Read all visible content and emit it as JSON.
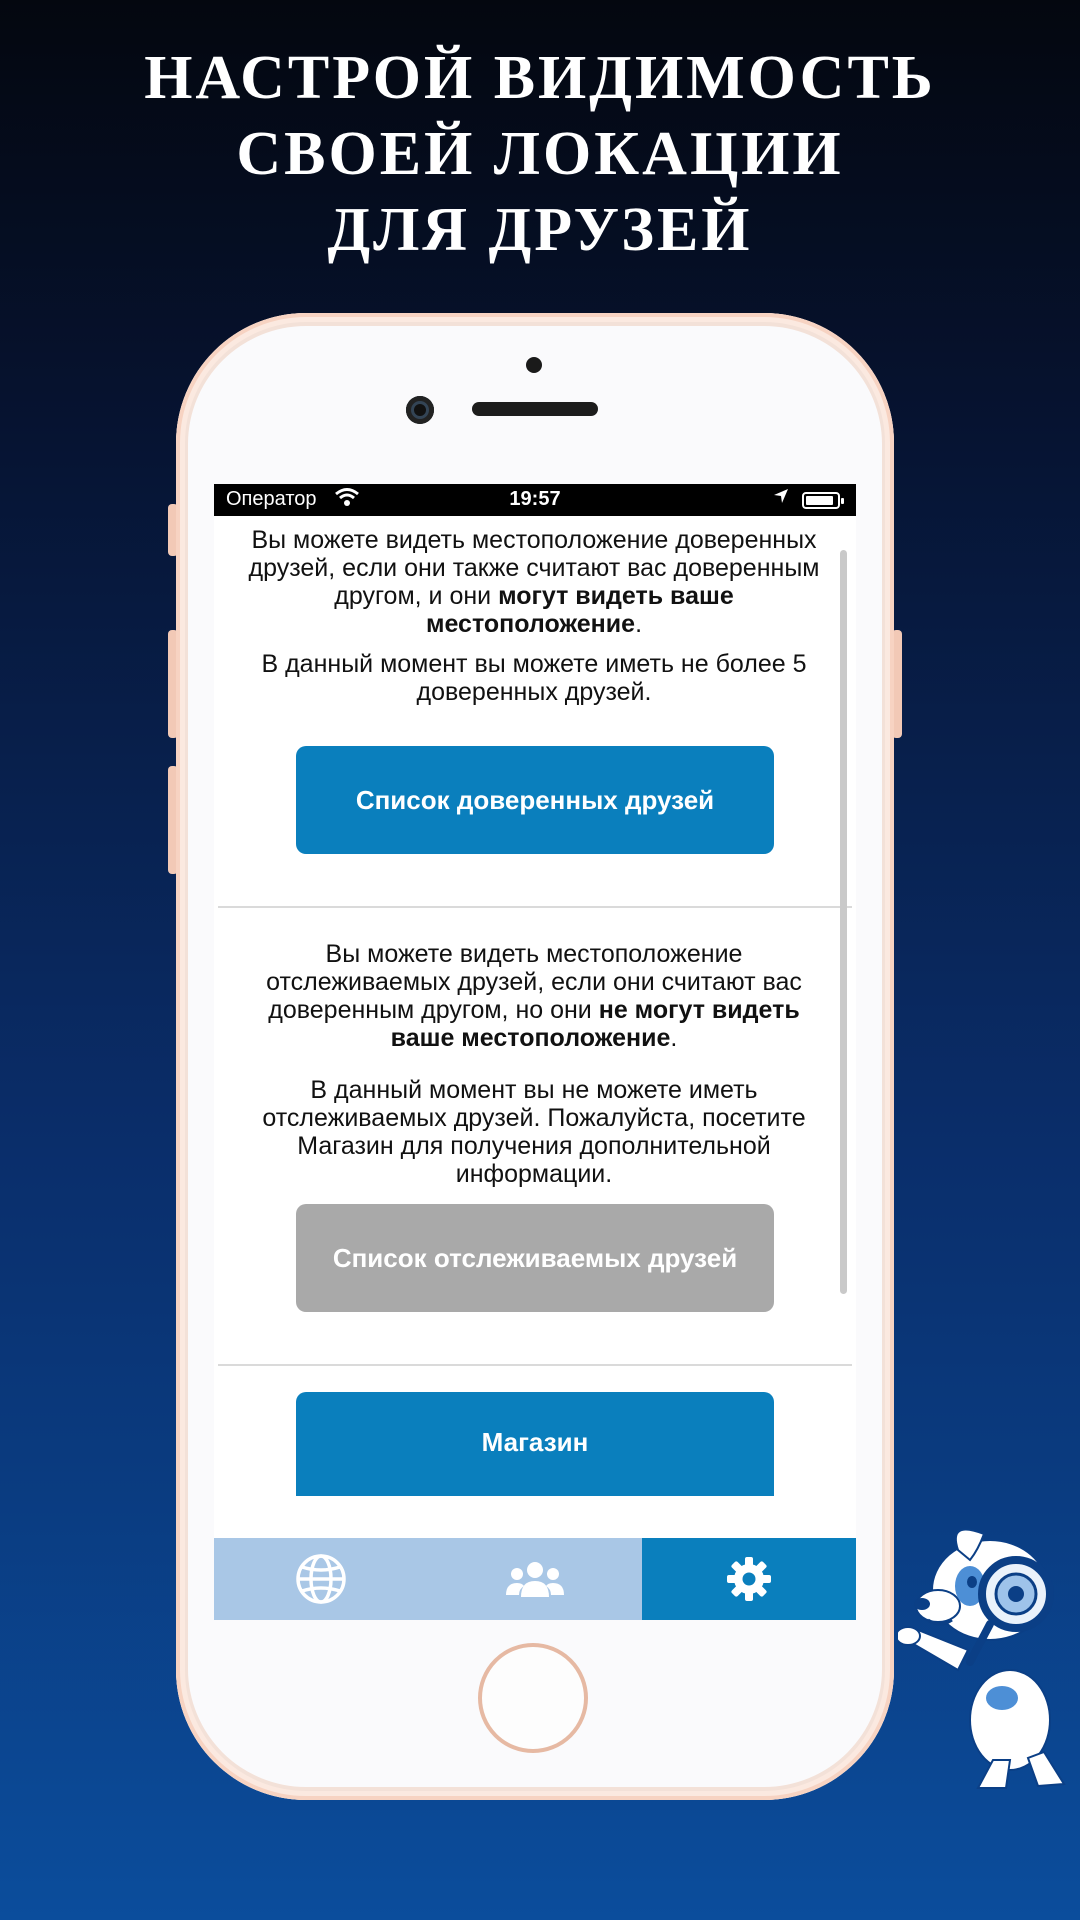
{
  "headline": {
    "line1": "НАСТРОЙ ВИДИМОСТЬ",
    "line2": "СВОЕЙ ЛОКАЦИИ",
    "line3": "ДЛЯ ДРУЗЕЙ"
  },
  "statusbar": {
    "carrier": "Оператор",
    "time": "19:57",
    "battery_level": 0.9
  },
  "trusted": {
    "text_a": "Вы можете видеть местоположение доверенных друзей, если они также считают вас доверенным другом, и они ",
    "text_bold": "могут видеть ваше местоположение",
    "text_end": ".",
    "limit_text": "В данный момент вы можете иметь не более 5 доверенных друзей.",
    "button_label": "Список доверенных друзей"
  },
  "tracked": {
    "text_a": "Вы можете видеть местоположение отслеживаемых друзей, если они считают вас доверенным другом, но они ",
    "text_bold": "не могут видеть ваше местоположение",
    "text_end": ".",
    "limit_text": "В данный момент вы не можете иметь отслеживаемых друзей. Пожалуйста, посетите Магазин для получения дополнительной информации.",
    "button_label": "Список отслеживаемых друзей"
  },
  "store": {
    "button_label": "Магазин"
  },
  "tabbar": {
    "tabs": [
      {
        "icon": "globe-icon",
        "active": false
      },
      {
        "icon": "users-icon",
        "active": false
      },
      {
        "icon": "gear-icon",
        "active": true
      }
    ]
  },
  "colors": {
    "accent": "#0a7fbd",
    "disabled": "#a9a9a9",
    "tabbar": "#a9c7e6"
  }
}
